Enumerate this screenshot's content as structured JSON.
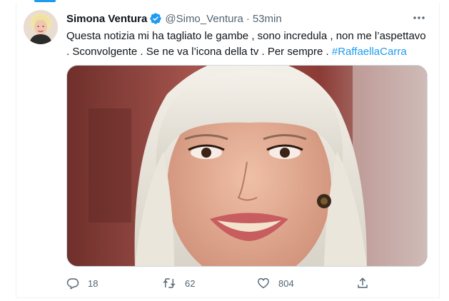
{
  "tweet": {
    "display_name": "Simona Ventura",
    "handle": "@Simo_Ventura",
    "separator": "·",
    "time": "53min",
    "text_line1": "Questa notizia mi ha tagliato le gambe , sono incredula , non me l’aspettavo",
    "text_line2": ". Sconvolgente .  Se ne va l’icona della tv . Per sempre . ",
    "hashtag": "#RaffaellaCarra",
    "verified": true
  },
  "actions": {
    "reply_count": "18",
    "retweet_count": "62",
    "like_count": "804"
  },
  "icons": {
    "verified": "verified-badge-icon",
    "more": "more-dots-icon",
    "reply": "reply-icon",
    "retweet": "retweet-icon",
    "like": "heart-icon",
    "share": "share-icon"
  },
  "colors": {
    "accent": "#1d9bf0",
    "text": "#0f1419",
    "secondary": "#536471",
    "border": "#eff3f4"
  }
}
